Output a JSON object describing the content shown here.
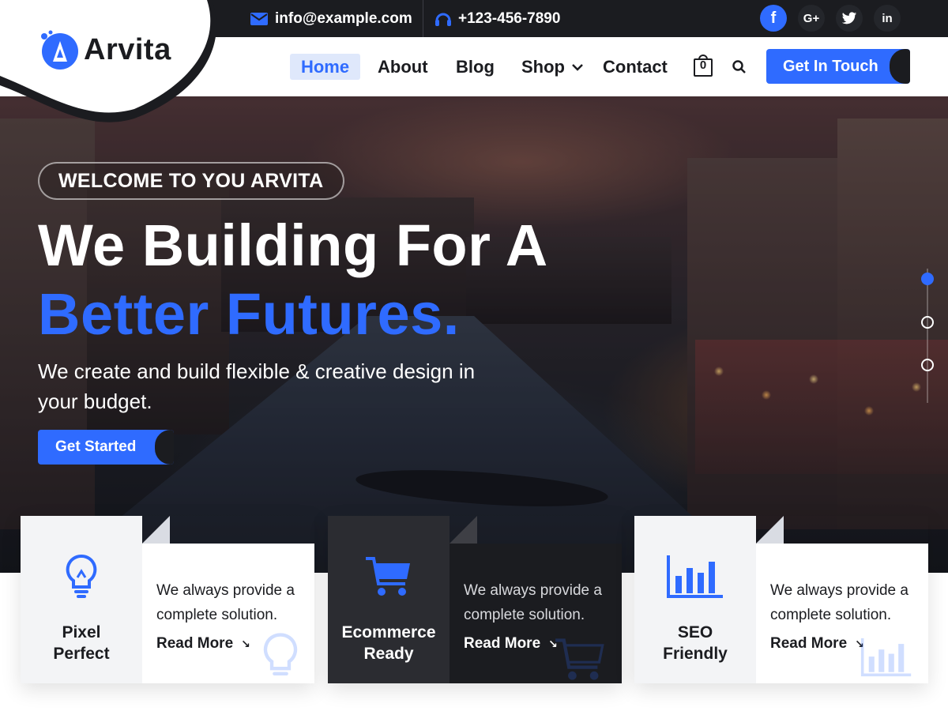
{
  "brand": {
    "name": "Arvita",
    "accent": "#2f6bff",
    "dark": "#1b1c20"
  },
  "topbar": {
    "email": "info@example.com",
    "phone": "+123-456-7890",
    "social": [
      {
        "icon": "facebook-icon",
        "glyph": "f"
      },
      {
        "icon": "google-plus-icon",
        "glyph": "G+"
      },
      {
        "icon": "twitter-icon",
        "glyph": ""
      },
      {
        "icon": "linkedin-icon",
        "glyph": "in"
      }
    ]
  },
  "nav": {
    "items": [
      "Home",
      "About",
      "Blog",
      "Shop",
      "Contact"
    ],
    "active": "Home",
    "cart_count": "0",
    "cta": "Get In Touch"
  },
  "hero": {
    "badge": "WELCOME TO YOU ARVITA",
    "headline_line1": "We Building For A",
    "headline_line2": "Better Futures.",
    "subtext": "We create and build flexible & creative design in your budget.",
    "button": "Get Started",
    "slides": 3,
    "active_slide": 1
  },
  "features": [
    {
      "title_line1": "Pixel",
      "title_line2": "Perfect",
      "icon": "lightbulb-icon",
      "desc": "We always provide a complete solution.",
      "link": "Read More"
    },
    {
      "title_line1": "Ecommerce",
      "title_line2": "Ready",
      "icon": "shopping-cart-icon",
      "desc": "We always provide a complete solution.",
      "link": "Read More"
    },
    {
      "title_line1": "SEO",
      "title_line2": "Friendly",
      "icon": "bar-chart-icon",
      "desc": "We always provide a complete solution.",
      "link": "Read More"
    }
  ]
}
